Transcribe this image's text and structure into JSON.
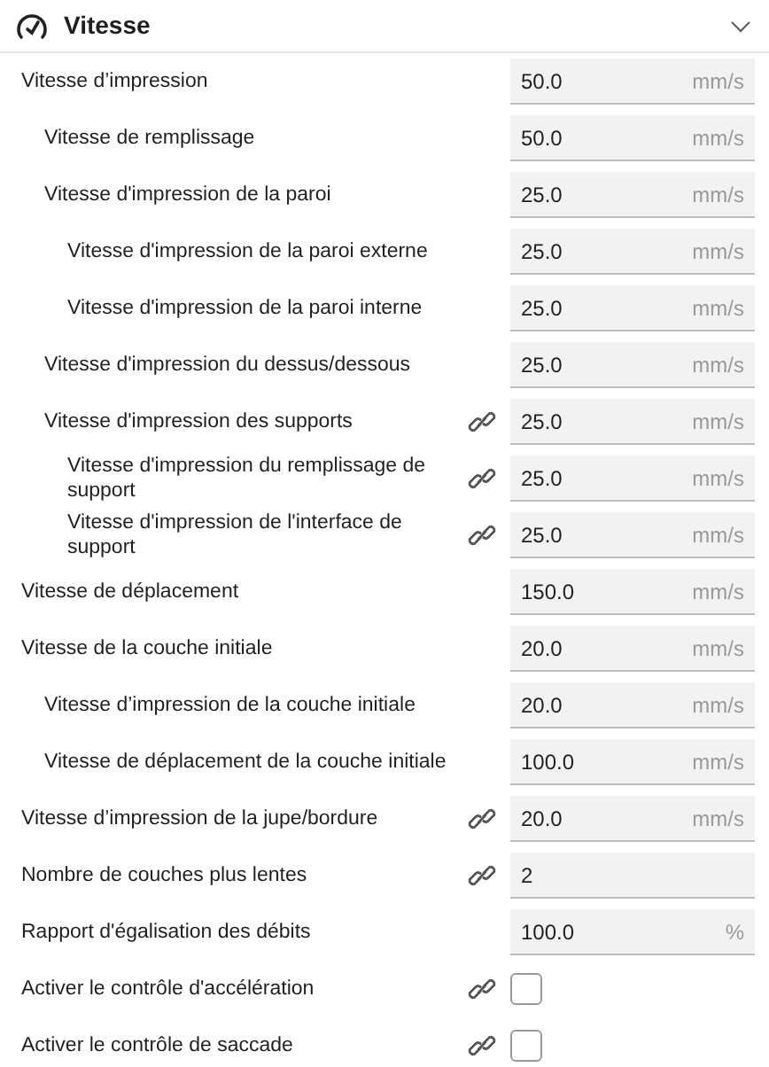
{
  "section": {
    "title": "Vitesse",
    "expanded": true
  },
  "settings": [
    {
      "kind": "number",
      "label": "Vitesse d’impression",
      "linked": false,
      "value": "50.0",
      "unit": "mm/s",
      "children": [
        {
          "kind": "number",
          "label": "Vitesse de remplissage",
          "linked": false,
          "value": "50.0",
          "unit": "mm/s"
        },
        {
          "kind": "number",
          "label": "Vitesse d'impression de la paroi",
          "linked": false,
          "value": "25.0",
          "unit": "mm/s",
          "children": [
            {
              "kind": "number",
              "label": "Vitesse d'impression de la paroi externe",
              "linked": false,
              "value": "25.0",
              "unit": "mm/s"
            },
            {
              "kind": "number",
              "label": "Vitesse d'impression de la paroi interne",
              "linked": false,
              "value": "25.0",
              "unit": "mm/s"
            }
          ]
        },
        {
          "kind": "number",
          "label": "Vitesse d'impression du dessus/dessous",
          "linked": false,
          "value": "25.0",
          "unit": "mm/s"
        },
        {
          "kind": "number",
          "label": "Vitesse d'impression des supports",
          "linked": true,
          "value": "25.0",
          "unit": "mm/s",
          "children": [
            {
              "kind": "number",
              "label": "Vitesse d'impression du remplissage de support",
              "linked": true,
              "value": "25.0",
              "unit": "mm/s"
            },
            {
              "kind": "number",
              "label": "Vitesse d'impression de l'interface de support",
              "linked": true,
              "value": "25.0",
              "unit": "mm/s"
            }
          ]
        }
      ]
    },
    {
      "kind": "number",
      "label": "Vitesse de déplacement",
      "linked": false,
      "value": "150.0",
      "unit": "mm/s"
    },
    {
      "kind": "number",
      "label": "Vitesse de la couche initiale",
      "linked": false,
      "value": "20.0",
      "unit": "mm/s",
      "children": [
        {
          "kind": "number",
          "label": "Vitesse d’impression de la couche initiale",
          "linked": false,
          "value": "20.0",
          "unit": "mm/s"
        },
        {
          "kind": "number",
          "label": "Vitesse de déplacement de la couche initiale",
          "linked": false,
          "value": "100.0",
          "unit": "mm/s"
        }
      ]
    },
    {
      "kind": "number",
      "label": "Vitesse d’impression de la jupe/bordure",
      "linked": true,
      "value": "20.0",
      "unit": "mm/s"
    },
    {
      "kind": "number",
      "label": "Nombre de couches plus lentes",
      "linked": true,
      "value": "2"
    },
    {
      "kind": "number",
      "label": "Rapport d'égalisation des débits",
      "linked": false,
      "value": "100.0",
      "unit": "%"
    },
    {
      "kind": "checkbox",
      "label": "Activer le contrôle d'accélération",
      "linked": true,
      "checked": false
    },
    {
      "kind": "checkbox",
      "label": "Activer le contrôle de saccade",
      "linked": true,
      "checked": false
    }
  ]
}
